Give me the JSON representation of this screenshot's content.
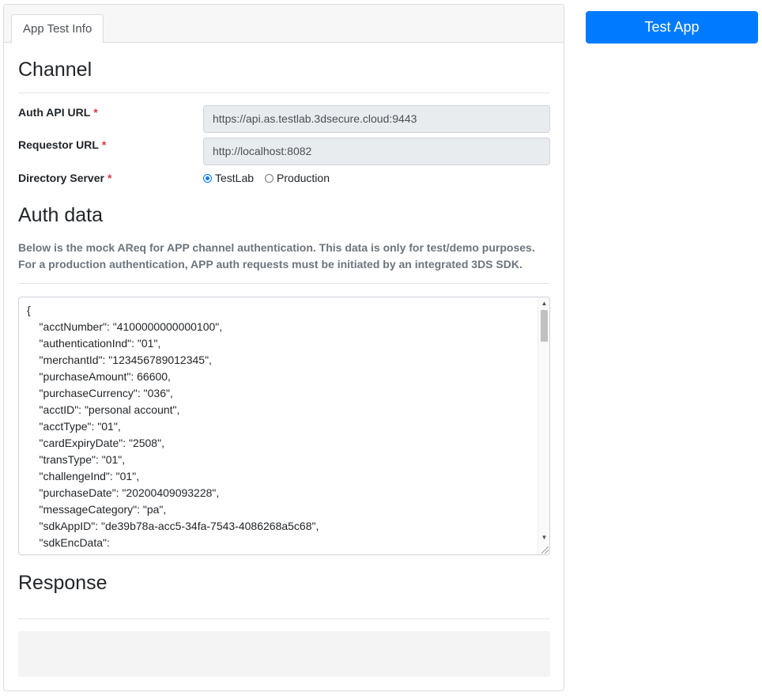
{
  "tabs": [
    {
      "label": "App Test Info"
    }
  ],
  "channel": {
    "heading": "Channel",
    "fields": [
      {
        "label": "Auth API URL",
        "value": "https://api.as.testlab.3dsecure.cloud:9443"
      },
      {
        "label": "Requestor URL",
        "value": "http://localhost:8082"
      }
    ],
    "directory_server": {
      "label": "Directory Server",
      "options": [
        "TestLab",
        "Production"
      ],
      "selected": "TestLab"
    },
    "required_marker": "*"
  },
  "auth_data": {
    "heading": "Auth data",
    "description": "Below is the mock AReq for APP channel authentication. This data is only for test/demo purposes. For a production authentication, APP auth requests must be initiated by an integrated 3DS SDK.",
    "areq_lines": [
      "{",
      "    \"acctNumber\": \"4100000000000100\",",
      "    \"authenticationInd\": \"01\",",
      "    \"merchantId\": \"123456789012345\",",
      "    \"purchaseAmount\": 66600,",
      "    \"purchaseCurrency\": \"036\",",
      "    \"acctID\": \"personal account\",",
      "    \"acctType\": \"01\",",
      "    \"cardExpiryDate\": \"2508\",",
      "    \"transType\": \"01\",",
      "    \"challengeInd\": \"01\",",
      "    \"purchaseDate\": \"20200409093228\",",
      "    \"messageCategory\": \"pa\",",
      "    \"sdkAppID\": \"de39b78a-acc5-34fa-7543-4086268a5c68\",",
      "    \"sdkEncData\":"
    ]
  },
  "response": {
    "heading": "Response",
    "content": ""
  },
  "actions": {
    "test_button": "Test App"
  },
  "colors": {
    "primary": "#007bff",
    "required": "#dc3545",
    "muted": "#6c757d"
  },
  "icons": {
    "scroll_up": "triangle-up",
    "scroll_down": "triangle-down",
    "resize": "resize-grip"
  }
}
